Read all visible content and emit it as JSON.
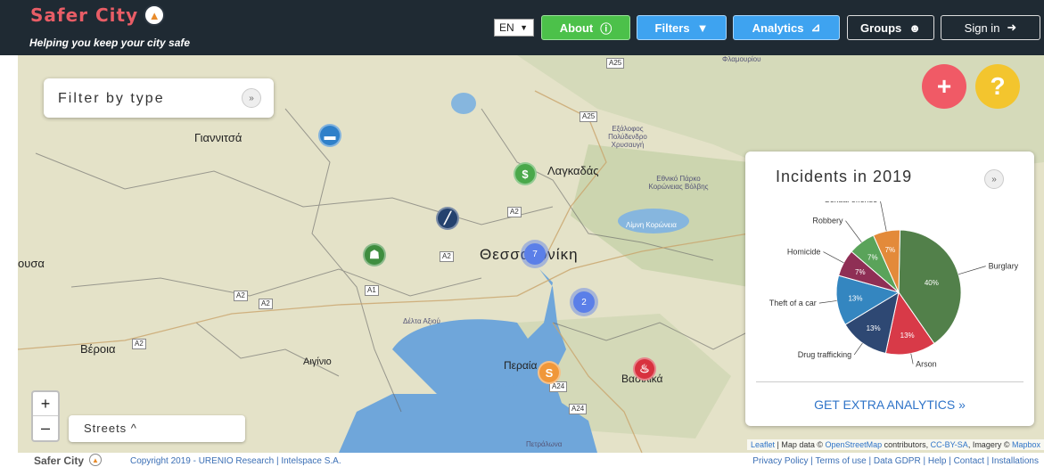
{
  "header": {
    "brand": "Safer City",
    "tagline": "Helping you keep your city safe",
    "language": "EN",
    "nav": {
      "about": "About",
      "filters": "Filters",
      "analytics": "Analytics",
      "groups": "Groups",
      "signin": "Sign in"
    }
  },
  "map": {
    "labels": {
      "giannitsa": "Γιαννιτσά",
      "lagkadas": "Λαγκαδάς",
      "thessaloniki": "Θεσσαλονίκη",
      "verroia": "Βέροια",
      "aiginio": "Αιγίνιο",
      "peraia": "Περαία",
      "vasilika": "Βασιλικά",
      "posa": "ουσα",
      "delta": "Δέλτα Αξιού",
      "koroneia": "Λίμνη Κορώνεια",
      "korona_park": "Εθνικό Πάρκο Κορώνειας Βόλβης",
      "park2": "Εξάλοφος Πολύδενδρο Χρυσαυγή",
      "peaks": "Φλαμουρίου",
      "petralona": "Πετράλωνα"
    },
    "roads": [
      "A25",
      "A25",
      "A2",
      "A2",
      "A2",
      "A1",
      "A2",
      "A2",
      "A24",
      "A24"
    ],
    "clusters": [
      "7",
      "2"
    ],
    "markers": [
      "car-icon",
      "money-bag-icon",
      "syringe-icon",
      "burglar-icon",
      "dollar-icon",
      "fire-icon"
    ]
  },
  "filter": {
    "title": "Filter by type"
  },
  "fab": {
    "add": "+",
    "help": "?"
  },
  "analytics_panel": {
    "title": "Incidents in 2019",
    "extra": "GET EXTRA ANALYTICS »"
  },
  "chart_data": {
    "type": "pie",
    "title": "Incidents in 2019",
    "series": [
      {
        "name": "Burglary",
        "value": 40,
        "color": "#52804a"
      },
      {
        "name": "Arson",
        "value": 13,
        "color": "#d83a48"
      },
      {
        "name": "Drug trafficking",
        "value": 13,
        "color": "#2e4873"
      },
      {
        "name": "Theft of a car",
        "value": 13,
        "color": "#3486c0"
      },
      {
        "name": "Homicide",
        "value": 7,
        "color": "#8f2f55"
      },
      {
        "name": "Robbery",
        "value": 7,
        "color": "#5aa35a"
      },
      {
        "name": "Sexual offense",
        "value": 7,
        "color": "#e38a3a"
      }
    ]
  },
  "controls": {
    "zoom_in": "+",
    "zoom_out": "–",
    "layer": "Streets ^"
  },
  "attribution": {
    "a": "Leaflet",
    "b": " | Map data © ",
    "c": "OpenStreetMap",
    "d": " contributors, ",
    "e": "CC-BY-SA",
    "f": ", Imagery © ",
    "g": "Mapbox"
  },
  "footer": {
    "brand": "Safer City",
    "copyright": "Copyright 2019 - URENIO Research  |  Intelspace S.A.",
    "links": "Privacy Policy  |  Terms of use  |  Data GDPR  |  Help  |  Contact  |  Installations"
  }
}
